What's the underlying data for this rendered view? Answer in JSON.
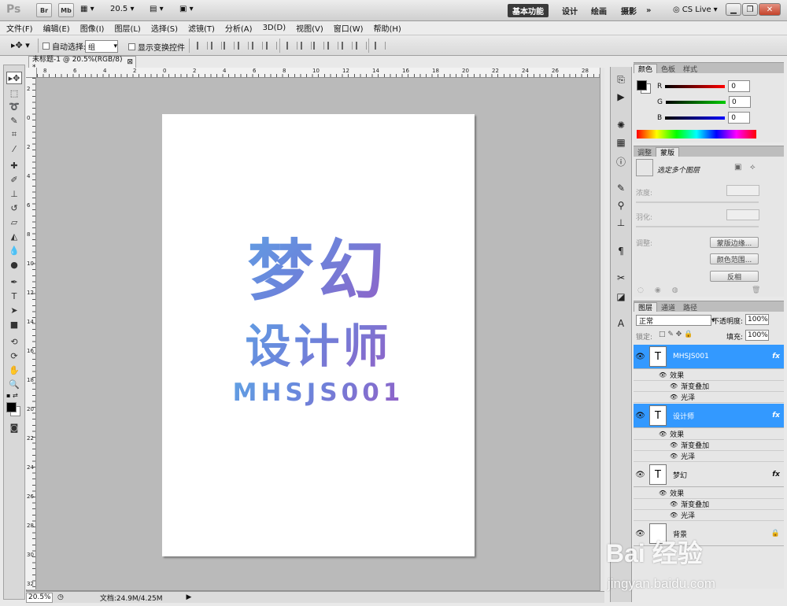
{
  "app": {
    "logo": "Ps",
    "bridge": "Br",
    "minibridge": "Mb",
    "zoom": "20.5",
    "workspaces": [
      "基本功能",
      "设计",
      "绘画",
      "摄影"
    ],
    "more": "»",
    "cs_live": "CS Live"
  },
  "menu": [
    "文件(F)",
    "编辑(E)",
    "图像(I)",
    "图层(L)",
    "选择(S)",
    "滤镜(T)",
    "分析(A)",
    "3D(D)",
    "视图(V)",
    "窗口(W)",
    "帮助(H)"
  ],
  "options": {
    "auto_select_label": "自动选择:",
    "group_value": "组",
    "show_transform_label": "显示变换控件"
  },
  "document": {
    "tab_title": "未标题-1 @ 20.5%(RGB/8) *",
    "ruler_top": [
      "8",
      "6",
      "4",
      "2",
      "0",
      "2",
      "4",
      "6",
      "8",
      "10",
      "12",
      "14",
      "16",
      "18",
      "20",
      "22",
      "24",
      "26",
      "28"
    ],
    "ruler_left": [
      "2",
      "0",
      "2",
      "4",
      "6",
      "8",
      "10",
      "12",
      "14",
      "16",
      "18",
      "20",
      "22",
      "24",
      "26",
      "28",
      "30",
      "32"
    ],
    "art_title": "梦幻",
    "art_subtitle": "设计师",
    "art_code": "MHSJS001",
    "gradient_colors": [
      "#57b8ea",
      "#6a86dc",
      "#8e64c9"
    ]
  },
  "status": {
    "zoom": "20.5%",
    "doc_info": "文档:24.9M/4.25M"
  },
  "color_panel": {
    "tabs": [
      "颜色",
      "色板",
      "样式"
    ],
    "channels": [
      {
        "label": "R",
        "value": "0",
        "color": "#ff0000"
      },
      {
        "label": "G",
        "value": "0",
        "color": "#00cc00"
      },
      {
        "label": "B",
        "value": "0",
        "color": "#0000ff"
      }
    ]
  },
  "masks_panel": {
    "tabs": [
      "调整",
      "蒙版"
    ],
    "status": "选定多个图层",
    "density": "浓度:",
    "feather": "羽化:",
    "refine": "调整:",
    "buttons": [
      "蒙版边缘...",
      "颜色范围...",
      "反相"
    ]
  },
  "layers_panel": {
    "tabs": [
      "图层",
      "通道",
      "路径"
    ],
    "blend_mode": "正常",
    "opacity_label": "不透明度:",
    "opacity": "100%",
    "lock_label": "锁定:",
    "fill_label": "填充:",
    "fill": "100%",
    "effects_label": "效果",
    "effect_gradient": "渐变叠加",
    "effect_satin": "光泽",
    "fx": "fx",
    "layers": [
      {
        "name": "MHSJS001",
        "selected": true
      },
      {
        "name": "设计师",
        "selected": true
      },
      {
        "name": "梦幻",
        "selected": false
      }
    ],
    "background_name": "背景"
  },
  "watermark": {
    "main": "Bai 经验",
    "sub": "jingyan.baidu.com"
  }
}
